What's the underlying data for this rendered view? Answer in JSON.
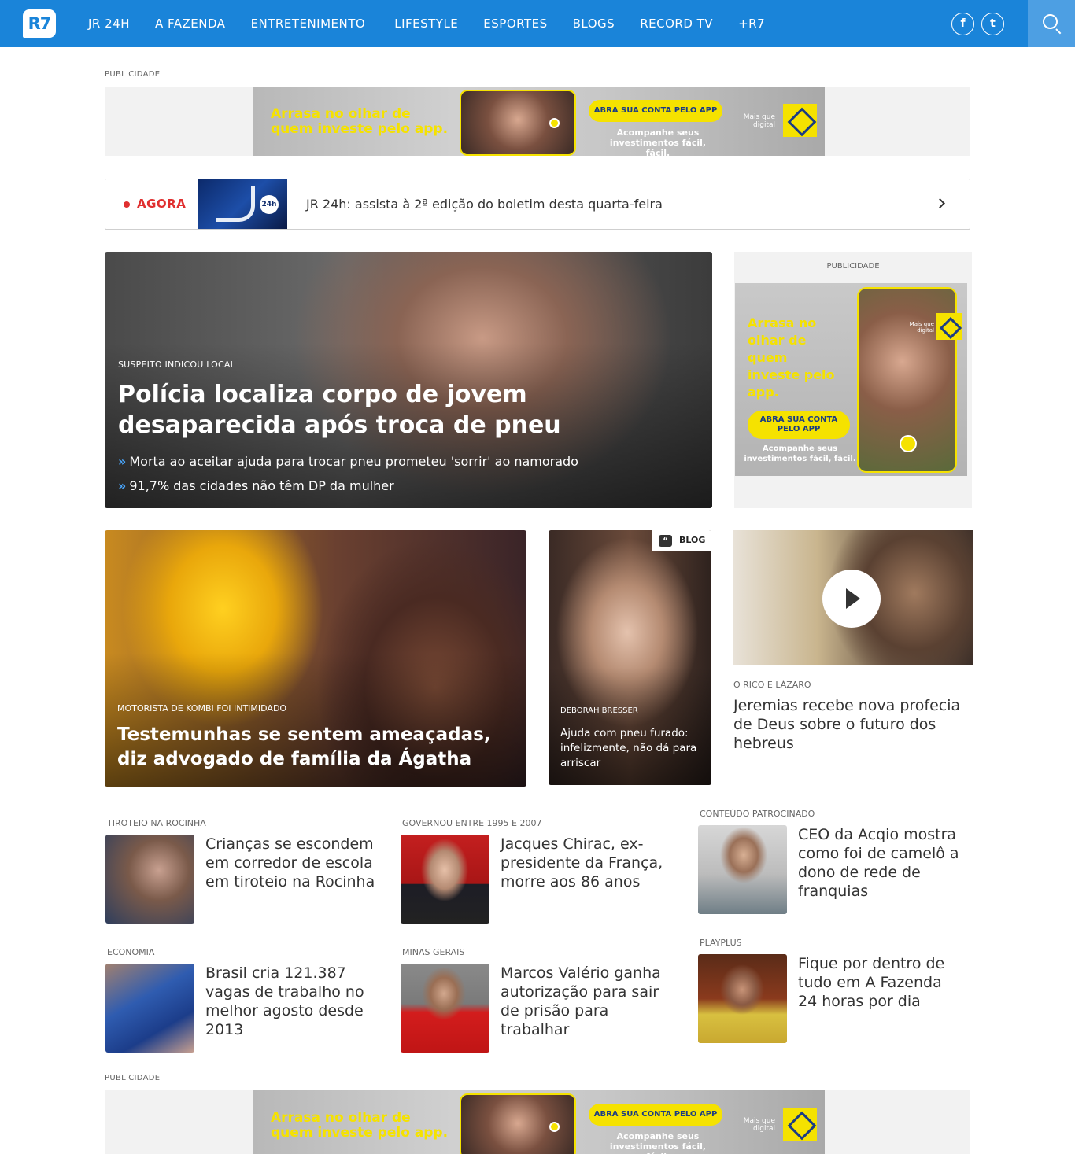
{
  "header": {
    "logo": "R7",
    "nav": [
      "JR 24H",
      "A FAZENDA",
      "ENTRETENIMENTO",
      "LIFESTYLE",
      "ESPORTES",
      "BLOGS",
      "RECORD TV",
      "+R7"
    ],
    "facebook_icon": "f",
    "twitter_icon": "t"
  },
  "ads": {
    "label": "PUBLICIDADE",
    "banner_headline": "Arrasa no olhar de quem investe pelo app.",
    "banner_cta": "ABRA SUA CONTA PELO APP",
    "banner_sub": "Acompanhe seus investimentos fácil, fácil.",
    "banner_brand": "Mais que digital",
    "side_headline": "Arrasa no olhar de quem investe pelo app.",
    "side_cta": "ABRA SUA CONTA PELO APP",
    "side_sub": "Acompanhe seus investimentos fácil, fácil.",
    "side_brand": "Mais que digital"
  },
  "agora": {
    "label": "AGORA",
    "thumb_badge": "24h",
    "headline": "JR 24h: assista à 2ª edição do boletim desta quarta-feira"
  },
  "hero": {
    "kicker": "SUSPEITO INDICOU LOCAL",
    "title": "Polícia localiza corpo de jovem desaparecida após troca de pneu",
    "related": [
      "Morta ao aceitar ajuda para trocar pneu prometeu 'sorrir' ao namorado",
      "91,7% das cidades não têm DP da mulher"
    ]
  },
  "cards": {
    "big": {
      "kicker": "MOTORISTA DE KOMBI FOI INTIMIDADO",
      "title": "Testemunhas se sentem ameaçadas, diz advogado de família da Ágatha"
    },
    "blog": {
      "tag": "BLOG",
      "kicker": "DEBORAH BRESSER",
      "title": "Ajuda com pneu furado: infelizmente, não dá para arriscar"
    },
    "video": {
      "kicker": "O RICO E LÁZARO",
      "title": "Jeremias recebe nova profecia de Deus sobre o futuro dos hebreus"
    }
  },
  "list": [
    {
      "kicker": "TIROTEIO NA ROCINHA",
      "title": "Crianças se escondem em corredor de escola em tiroteio na Rocinha"
    },
    {
      "kicker": "GOVERNOU ENTRE 1995 E 2007",
      "title": "Jacques Chirac, ex-presidente da França, morre aos 86 anos"
    },
    {
      "kicker": "CONTEÚDO PATROCINADO",
      "title": "CEO da Acqio mostra como foi de camelô a dono de rede de franquias"
    },
    {
      "kicker": "ECONOMIA",
      "title": "Brasil cria 121.387 vagas de trabalho no melhor agosto desde 2013"
    },
    {
      "kicker": "MINAS GERAIS",
      "title": "Marcos Valério ganha autorização para sair de prisão para trabalhar"
    },
    {
      "kicker": "PLAYPLUS",
      "title": "Fique por dentro de tudo em A Fazenda 24 horas por dia"
    }
  ],
  "colors": {
    "brand": "#1a84d9",
    "live": "#e02f2f",
    "ad_yellow": "#f5e200"
  }
}
